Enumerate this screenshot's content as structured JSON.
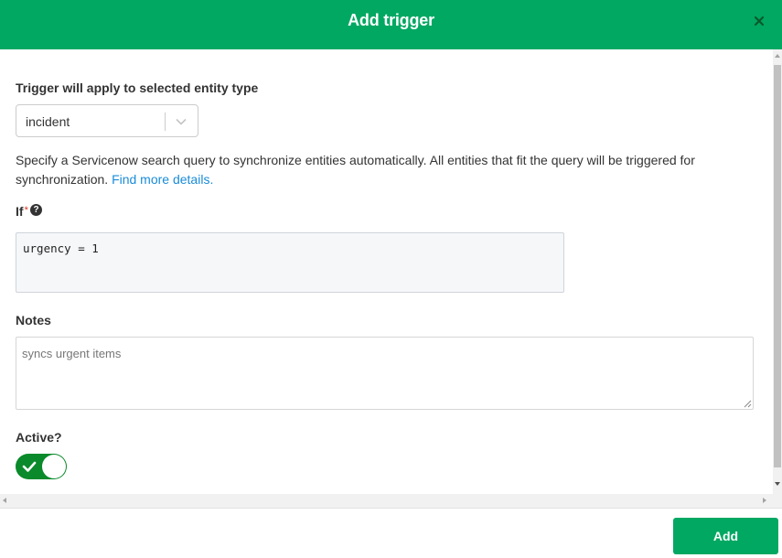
{
  "dialog": {
    "title": "Add trigger",
    "close_icon": "close-icon",
    "accent_color": "#00a862"
  },
  "entity": {
    "label": "Trigger will apply to selected entity type",
    "selected": "incident"
  },
  "description": {
    "text": "Specify a Servicenow search query to synchronize entities automatically. All entities that fit the query will be triggered for synchronization.",
    "link": "Find more details."
  },
  "query": {
    "label": "If",
    "required_marker": "*",
    "help_icon": "?",
    "value": "urgency = 1"
  },
  "notes": {
    "label": "Notes",
    "value": "syncs urgent items"
  },
  "active": {
    "label": "Active?",
    "enabled": true,
    "toggle_color": "#0a8a2a"
  },
  "footer": {
    "add_label": "Add"
  }
}
